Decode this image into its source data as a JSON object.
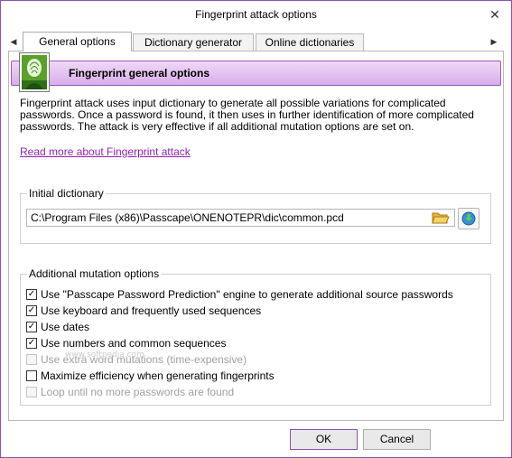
{
  "window": {
    "title": "Fingerprint attack options",
    "close_glyph": "✕"
  },
  "tabs": {
    "scroll_left": "◀",
    "scroll_right": "▶",
    "items": [
      {
        "label": "General options",
        "active": true
      },
      {
        "label": "Dictionary generator",
        "active": false
      },
      {
        "label": "Online dictionaries",
        "active": false
      }
    ]
  },
  "header": {
    "title": "Fingerprint general options",
    "icon": "fingerprint-user-icon"
  },
  "description": "Fingerprint attack uses input dictionary to generate all possible variations for complicated passwords. Once a password is found, it then uses in further identification of more complicated passwords. The attack is very effective if all additional mutation options are set on.",
  "link_text": "Read more about Fingerprint attack",
  "initial_dictionary": {
    "label": "Initial dictionary",
    "path": "C:\\Program Files (x86)\\Passcape\\ONENOTEPR\\dic\\common.pcd",
    "browse_icon": "folder-open-icon",
    "go_icon": "download-arrow-icon"
  },
  "mutation": {
    "label": "Additional mutation options",
    "options": [
      {
        "label": "Use \"Passcape Password Prediction\" engine to generate additional source passwords",
        "checked": true,
        "enabled": true
      },
      {
        "label": "Use keyboard and frequently used sequences",
        "checked": true,
        "enabled": true
      },
      {
        "label": "Use dates",
        "checked": true,
        "enabled": true
      },
      {
        "label": "Use numbers and common sequences",
        "checked": true,
        "enabled": true
      },
      {
        "label": "Use extra word mutations (time-expensive)",
        "checked": false,
        "enabled": false
      },
      {
        "label": "Maximize efficiency when generating fingerprints",
        "checked": false,
        "enabled": true
      },
      {
        "label": "Loop until no more passwords are found",
        "checked": false,
        "enabled": false
      }
    ]
  },
  "watermark": "www.softpedia.com",
  "buttons": {
    "ok": "OK",
    "cancel": "Cancel"
  },
  "colors": {
    "accent": "#8a52a8",
    "link": "#8e24aa",
    "header_gradient_top": "#efd8f7",
    "header_gradient_bottom": "#d9aee9"
  }
}
